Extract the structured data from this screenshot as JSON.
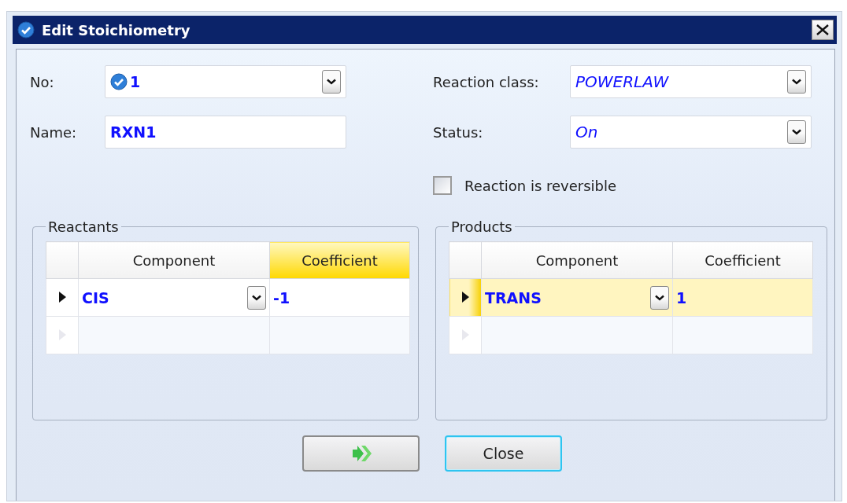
{
  "window": {
    "title": "Edit Stoichiometry"
  },
  "fields_left": [
    {
      "kind": "icon-combo",
      "label": "No:",
      "value": "1"
    },
    {
      "kind": "text",
      "label": "Name:",
      "value": "RXN1"
    }
  ],
  "fields_right": [
    {
      "kind": "combo",
      "label": "Reaction class:",
      "value": "POWERLAW"
    },
    {
      "kind": "combo",
      "label": "Status:",
      "value": "On"
    }
  ],
  "reversible": {
    "label": "Reaction is reversible",
    "checked": false
  },
  "groups": [
    {
      "title": "Reactants",
      "columns": [
        {
          "label": "Component",
          "selected": false
        },
        {
          "label": "Coefficient",
          "selected": true
        }
      ],
      "rows": [
        {
          "kind": "data",
          "component": "CIS",
          "coefficient": "-1",
          "current": true,
          "selected": false
        },
        {
          "kind": "new"
        }
      ]
    },
    {
      "title": "Products",
      "columns": [
        {
          "label": "Component",
          "selected": false
        },
        {
          "label": "Coefficient",
          "selected": false
        }
      ],
      "rows": [
        {
          "kind": "data",
          "component": "TRANS",
          "coefficient": "1",
          "current": true,
          "selected": true
        },
        {
          "kind": "new"
        }
      ]
    }
  ],
  "buttons": [
    {
      "kind": "run",
      "focused": false
    },
    {
      "kind": "text",
      "label": "Close",
      "focused": true
    }
  ]
}
